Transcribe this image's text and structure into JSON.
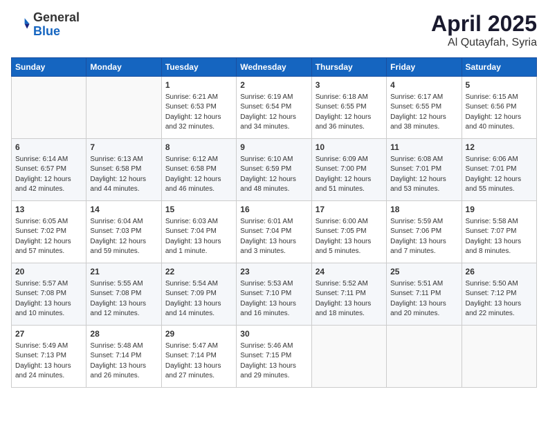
{
  "logo": {
    "text_general": "General",
    "text_blue": "Blue"
  },
  "title": "April 2025",
  "subtitle": "Al Qutayfah, Syria",
  "headers": [
    "Sunday",
    "Monday",
    "Tuesday",
    "Wednesday",
    "Thursday",
    "Friday",
    "Saturday"
  ],
  "weeks": [
    [
      {
        "day": "",
        "info": ""
      },
      {
        "day": "",
        "info": ""
      },
      {
        "day": "1",
        "info": "Sunrise: 6:21 AM\nSunset: 6:53 PM\nDaylight: 12 hours\nand 32 minutes."
      },
      {
        "day": "2",
        "info": "Sunrise: 6:19 AM\nSunset: 6:54 PM\nDaylight: 12 hours\nand 34 minutes."
      },
      {
        "day": "3",
        "info": "Sunrise: 6:18 AM\nSunset: 6:55 PM\nDaylight: 12 hours\nand 36 minutes."
      },
      {
        "day": "4",
        "info": "Sunrise: 6:17 AM\nSunset: 6:55 PM\nDaylight: 12 hours\nand 38 minutes."
      },
      {
        "day": "5",
        "info": "Sunrise: 6:15 AM\nSunset: 6:56 PM\nDaylight: 12 hours\nand 40 minutes."
      }
    ],
    [
      {
        "day": "6",
        "info": "Sunrise: 6:14 AM\nSunset: 6:57 PM\nDaylight: 12 hours\nand 42 minutes."
      },
      {
        "day": "7",
        "info": "Sunrise: 6:13 AM\nSunset: 6:58 PM\nDaylight: 12 hours\nand 44 minutes."
      },
      {
        "day": "8",
        "info": "Sunrise: 6:12 AM\nSunset: 6:58 PM\nDaylight: 12 hours\nand 46 minutes."
      },
      {
        "day": "9",
        "info": "Sunrise: 6:10 AM\nSunset: 6:59 PM\nDaylight: 12 hours\nand 48 minutes."
      },
      {
        "day": "10",
        "info": "Sunrise: 6:09 AM\nSunset: 7:00 PM\nDaylight: 12 hours\nand 51 minutes."
      },
      {
        "day": "11",
        "info": "Sunrise: 6:08 AM\nSunset: 7:01 PM\nDaylight: 12 hours\nand 53 minutes."
      },
      {
        "day": "12",
        "info": "Sunrise: 6:06 AM\nSunset: 7:01 PM\nDaylight: 12 hours\nand 55 minutes."
      }
    ],
    [
      {
        "day": "13",
        "info": "Sunrise: 6:05 AM\nSunset: 7:02 PM\nDaylight: 12 hours\nand 57 minutes."
      },
      {
        "day": "14",
        "info": "Sunrise: 6:04 AM\nSunset: 7:03 PM\nDaylight: 12 hours\nand 59 minutes."
      },
      {
        "day": "15",
        "info": "Sunrise: 6:03 AM\nSunset: 7:04 PM\nDaylight: 13 hours\nand 1 minute."
      },
      {
        "day": "16",
        "info": "Sunrise: 6:01 AM\nSunset: 7:04 PM\nDaylight: 13 hours\nand 3 minutes."
      },
      {
        "day": "17",
        "info": "Sunrise: 6:00 AM\nSunset: 7:05 PM\nDaylight: 13 hours\nand 5 minutes."
      },
      {
        "day": "18",
        "info": "Sunrise: 5:59 AM\nSunset: 7:06 PM\nDaylight: 13 hours\nand 7 minutes."
      },
      {
        "day": "19",
        "info": "Sunrise: 5:58 AM\nSunset: 7:07 PM\nDaylight: 13 hours\nand 8 minutes."
      }
    ],
    [
      {
        "day": "20",
        "info": "Sunrise: 5:57 AM\nSunset: 7:08 PM\nDaylight: 13 hours\nand 10 minutes."
      },
      {
        "day": "21",
        "info": "Sunrise: 5:55 AM\nSunset: 7:08 PM\nDaylight: 13 hours\nand 12 minutes."
      },
      {
        "day": "22",
        "info": "Sunrise: 5:54 AM\nSunset: 7:09 PM\nDaylight: 13 hours\nand 14 minutes."
      },
      {
        "day": "23",
        "info": "Sunrise: 5:53 AM\nSunset: 7:10 PM\nDaylight: 13 hours\nand 16 minutes."
      },
      {
        "day": "24",
        "info": "Sunrise: 5:52 AM\nSunset: 7:11 PM\nDaylight: 13 hours\nand 18 minutes."
      },
      {
        "day": "25",
        "info": "Sunrise: 5:51 AM\nSunset: 7:11 PM\nDaylight: 13 hours\nand 20 minutes."
      },
      {
        "day": "26",
        "info": "Sunrise: 5:50 AM\nSunset: 7:12 PM\nDaylight: 13 hours\nand 22 minutes."
      }
    ],
    [
      {
        "day": "27",
        "info": "Sunrise: 5:49 AM\nSunset: 7:13 PM\nDaylight: 13 hours\nand 24 minutes."
      },
      {
        "day": "28",
        "info": "Sunrise: 5:48 AM\nSunset: 7:14 PM\nDaylight: 13 hours\nand 26 minutes."
      },
      {
        "day": "29",
        "info": "Sunrise: 5:47 AM\nSunset: 7:14 PM\nDaylight: 13 hours\nand 27 minutes."
      },
      {
        "day": "30",
        "info": "Sunrise: 5:46 AM\nSunset: 7:15 PM\nDaylight: 13 hours\nand 29 minutes."
      },
      {
        "day": "",
        "info": ""
      },
      {
        "day": "",
        "info": ""
      },
      {
        "day": "",
        "info": ""
      }
    ]
  ]
}
